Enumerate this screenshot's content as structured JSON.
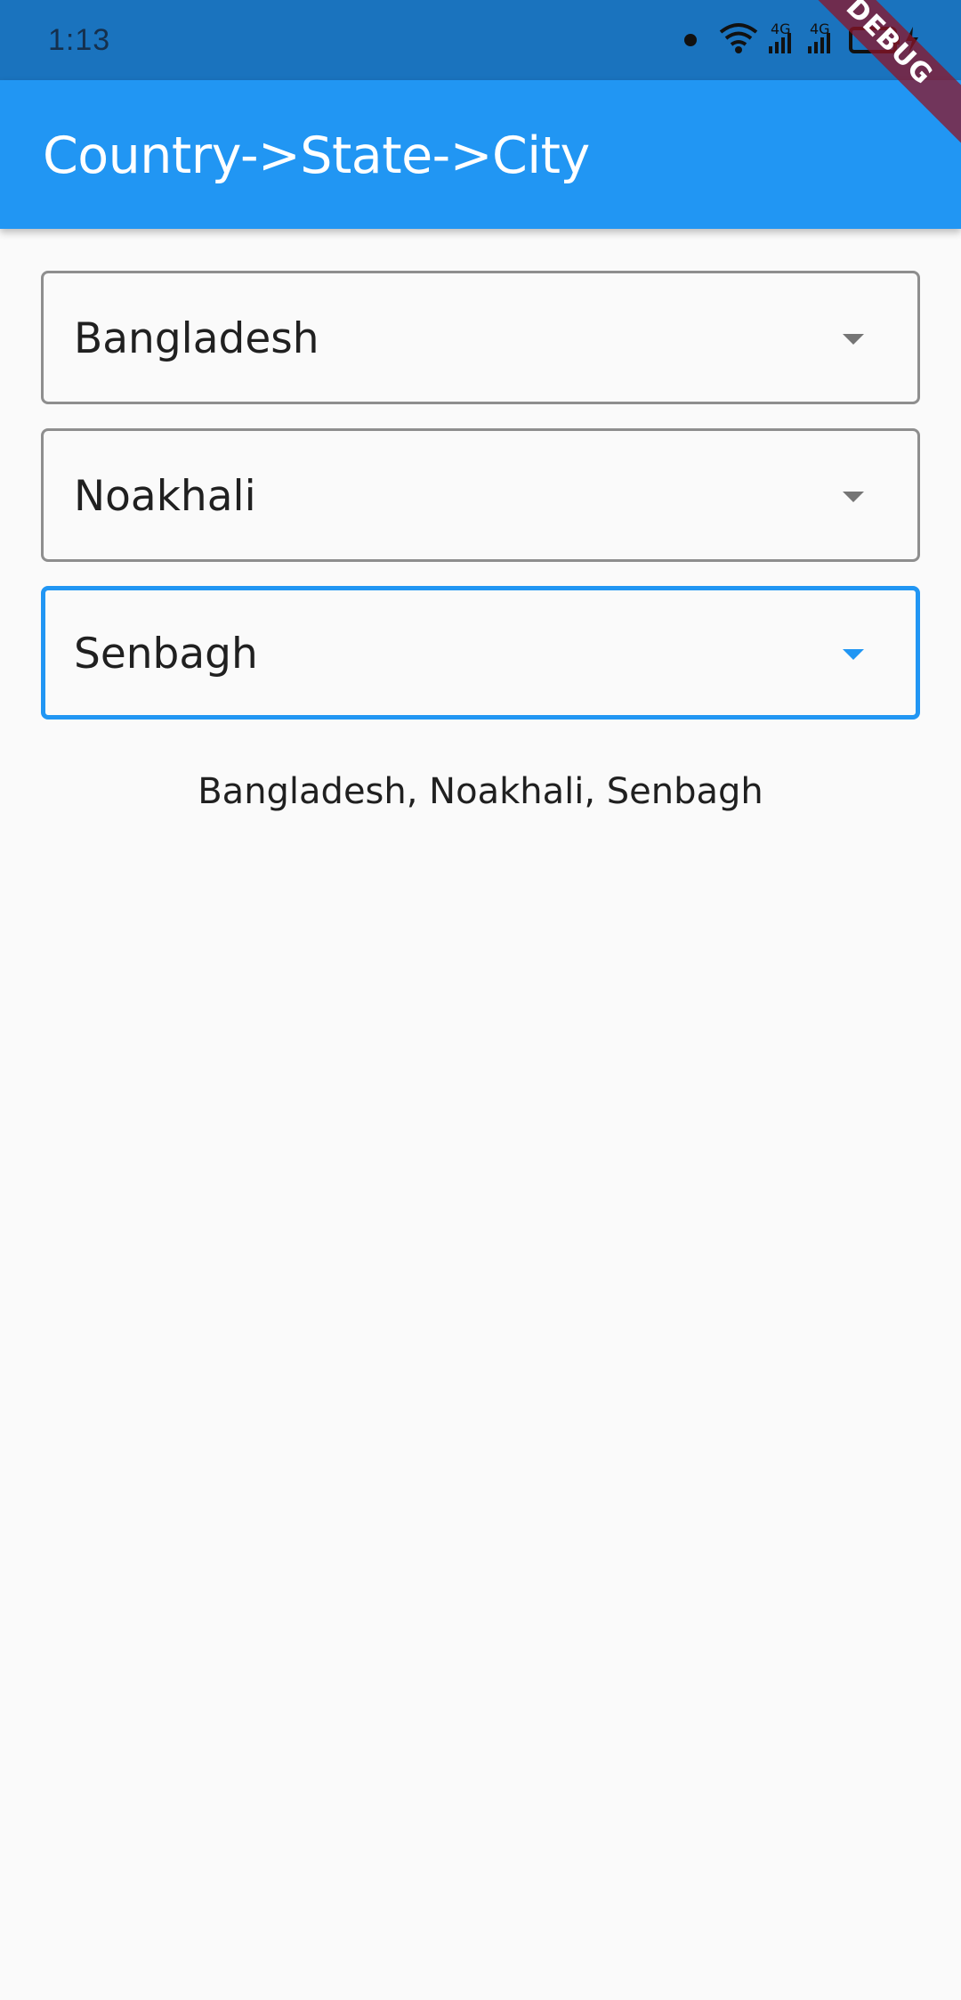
{
  "status_bar": {
    "time": "1:13",
    "icons": [
      "notification-dot-icon",
      "wifi-icon",
      "signal-4g-icon",
      "signal-4g-icon",
      "battery-charging-icon"
    ],
    "signal_label": "4G"
  },
  "debug_banner": "DEBUG",
  "app_bar": {
    "title": "Country->State->City"
  },
  "country_dropdown": {
    "value": "Bangladesh"
  },
  "state_dropdown": {
    "value": "Noakhali"
  },
  "city_dropdown": {
    "value": "Senbagh"
  },
  "summary": {
    "text": "Bangladesh, Noakhali, Senbagh"
  },
  "colors": {
    "status_bar": "#1a73be",
    "app_bar": "#2196f3",
    "focus_accent": "#2196f3",
    "background": "#fafafa"
  }
}
